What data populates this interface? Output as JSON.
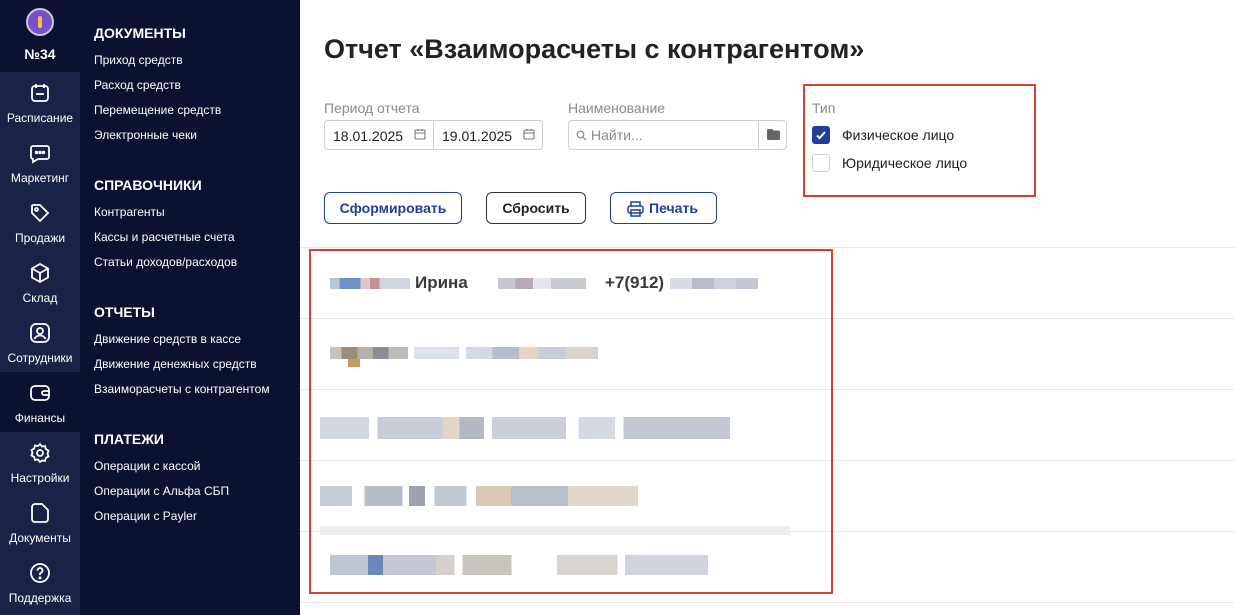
{
  "rail": {
    "badge": "№34",
    "items": [
      {
        "label": "Расписание",
        "icon": "calendar-icon"
      },
      {
        "label": "Маркетинг",
        "icon": "chat-icon"
      },
      {
        "label": "Продажи",
        "icon": "tag-icon"
      },
      {
        "label": "Склад",
        "icon": "box-icon"
      },
      {
        "label": "Сотрудники",
        "icon": "person-icon"
      },
      {
        "label": "Финансы",
        "icon": "wallet-icon"
      },
      {
        "label": "Настройки",
        "icon": "gear-icon"
      },
      {
        "label": "Документы",
        "icon": "document-icon"
      },
      {
        "label": "Поддержка",
        "icon": "help-icon"
      }
    ]
  },
  "menu": {
    "sections": [
      {
        "title": "ДОКУМЕНТЫ",
        "items": [
          "Приход средств",
          "Расход средств",
          "Перемещение средств",
          "Электронные чеки"
        ]
      },
      {
        "title": "СПРАВОЧНИКИ",
        "items": [
          "Контрагенты",
          "Кассы и расчетные счета",
          "Статьи доходов/расходов"
        ]
      },
      {
        "title": "ОТЧЕТЫ",
        "items": [
          "Движение средств в кассе",
          "Движение денежных средств",
          "Взаиморасчеты с контрагентом"
        ]
      },
      {
        "title": "ПЛАТЕЖИ",
        "items": [
          "Операции с кассой",
          "Операции с Альфа СБП",
          "Операции с Payler"
        ]
      }
    ]
  },
  "main": {
    "title": "Отчет «Взаиморасчеты с контрагентом»",
    "period": {
      "label": "Период отчета",
      "from": "18.01.2025",
      "to": "19.01.2025"
    },
    "name": {
      "label": "Наименование",
      "placeholder": "Найти..."
    },
    "type": {
      "label": "Тип",
      "options": [
        {
          "label": "Физическое лицо",
          "checked": true
        },
        {
          "label": "Юридическое лицо",
          "checked": false
        }
      ]
    },
    "buttons": {
      "generate": "Сформировать",
      "reset": "Сбросить",
      "print": "Печать"
    },
    "result": {
      "name": "Ирина",
      "phone": "+7(912)"
    }
  },
  "colors": {
    "sidebar": "#1b2247",
    "menu": "#0b1130",
    "accent": "#1f3f9a",
    "highlight": "#d0423a"
  }
}
